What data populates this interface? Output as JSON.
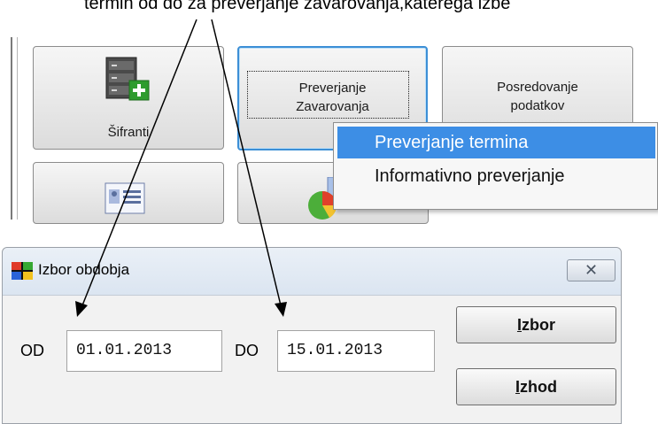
{
  "annotation": {
    "text": "termin od do za preverjanje zavarovanja,katerega izbe"
  },
  "toolbar": {
    "tiles": [
      {
        "label": "Šifranti",
        "icon": "server-add-icon"
      },
      {
        "label_line1": "Preverjanje",
        "label_line2": "Zavarovanja"
      },
      {
        "label_line1": "Posredovanje",
        "label_line2": "podatkov"
      },
      {
        "icon": "id-card-icon"
      },
      {
        "icon": "pie-chart-icon"
      }
    ]
  },
  "context_menu": {
    "items": [
      {
        "label": "Preverjanje termina",
        "selected": true
      },
      {
        "label": "Informativno preverjanje",
        "selected": false
      }
    ]
  },
  "dialog": {
    "title": "Izbor obdobja",
    "app_icon": "windows-flag-icon",
    "close_glyph": "✕",
    "from_label": "OD",
    "from_value": "01.01.2013",
    "to_label": "DO",
    "to_value": "15.01.2013",
    "izbor_first": "I",
    "izbor_rest": "zbor",
    "izhod_first": "I",
    "izhod_rest": "zhod"
  },
  "colors": {
    "selection": "#3d8ee5",
    "focus_border": "#3c8fd6"
  }
}
